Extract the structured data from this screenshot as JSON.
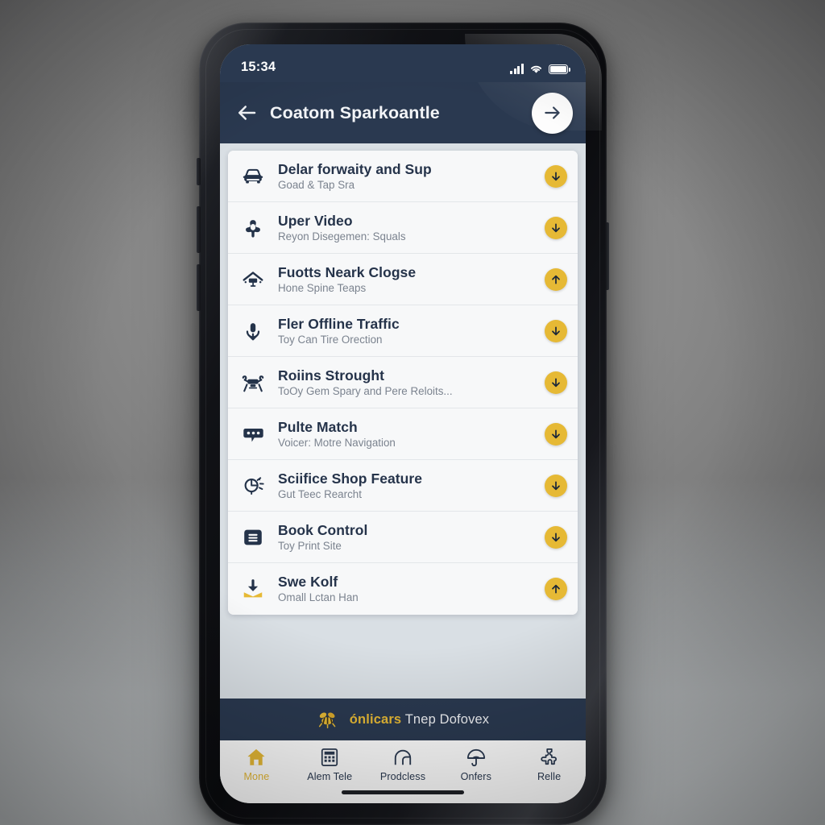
{
  "device": {
    "type": "smartphone-mockup",
    "home_indicator": true
  },
  "status_bar": {
    "time": "15:34",
    "signal_icon": "cellular-signal-icon",
    "wifi_icon": "wifi-icon",
    "battery_icon": "battery-full-icon"
  },
  "app_bar": {
    "back_icon": "back-arrow-icon",
    "title": "Coatom Sparkoantle",
    "forward_icon": "forward-arrow-icon"
  },
  "list": {
    "items": [
      {
        "icon": "car-icon",
        "title": "Delar forwaity and Sup",
        "subtitle": "Goad & Tap Sra",
        "badge": "down-arrow-icon",
        "badge_direction": "down"
      },
      {
        "icon": "bell-shape-icon",
        "title": "Uper Video",
        "subtitle": "Reyon Disegemen: Squals",
        "badge": "down-arrow-icon",
        "badge_direction": "down"
      },
      {
        "icon": "house-sign-icon",
        "title": "Fuotts Neark Clogse",
        "subtitle": "Hone Spine Teaps",
        "badge": "up-arrow-icon",
        "badge_direction": "up"
      },
      {
        "icon": "microphone-download-icon",
        "title": "Fler Offline Traffic",
        "subtitle": "Toy Can Tire Orection",
        "badge": "down-arrow-icon",
        "badge_direction": "down"
      },
      {
        "icon": "drone-icon",
        "title": "Roiins Strought",
        "subtitle": "ToOy Gem Spary and Pere Reloits...",
        "badge": "down-arrow-icon",
        "badge_direction": "down"
      },
      {
        "icon": "chat-bubble-icon",
        "title": "Pulte Match",
        "subtitle": "Voicer: Motre Navigation",
        "badge": "down-arrow-icon",
        "badge_direction": "down"
      },
      {
        "icon": "clock-timer-icon",
        "title": "Sciifice Shop Feature",
        "subtitle": "Gut Teec Rearcht",
        "badge": "down-arrow-icon",
        "badge_direction": "down"
      },
      {
        "icon": "list-menu-icon",
        "title": "Book Control",
        "subtitle": "Toy Print Site",
        "badge": "down-arrow-icon",
        "badge_direction": "down"
      },
      {
        "icon": "inbox-download-icon",
        "title": "Swe Kolf",
        "subtitle": "Omall Lctan Han",
        "badge": "up-arrow-icon",
        "badge_direction": "up"
      }
    ]
  },
  "banner": {
    "icon": "bee-icon",
    "brand": "ónlicars",
    "text": "Tnep Dofovex"
  },
  "tab_bar": {
    "tabs": [
      {
        "icon": "home-icon",
        "label": "Mone",
        "active": true
      },
      {
        "icon": "grid-icon",
        "label": "Alem Tele",
        "active": false
      },
      {
        "icon": "arch-icon",
        "label": "Prodcless",
        "active": false
      },
      {
        "icon": "umbrella-icon",
        "label": "Onfers",
        "active": false
      },
      {
        "icon": "puzzle-icon",
        "label": "Relle",
        "active": false
      }
    ]
  },
  "colors": {
    "navy": "#2a3950",
    "gold": "#e6b935",
    "card": "#f7f8f9",
    "page_bg": "#d9dfe4",
    "title_text": "#25334a",
    "subtitle_text": "#7b838f"
  }
}
